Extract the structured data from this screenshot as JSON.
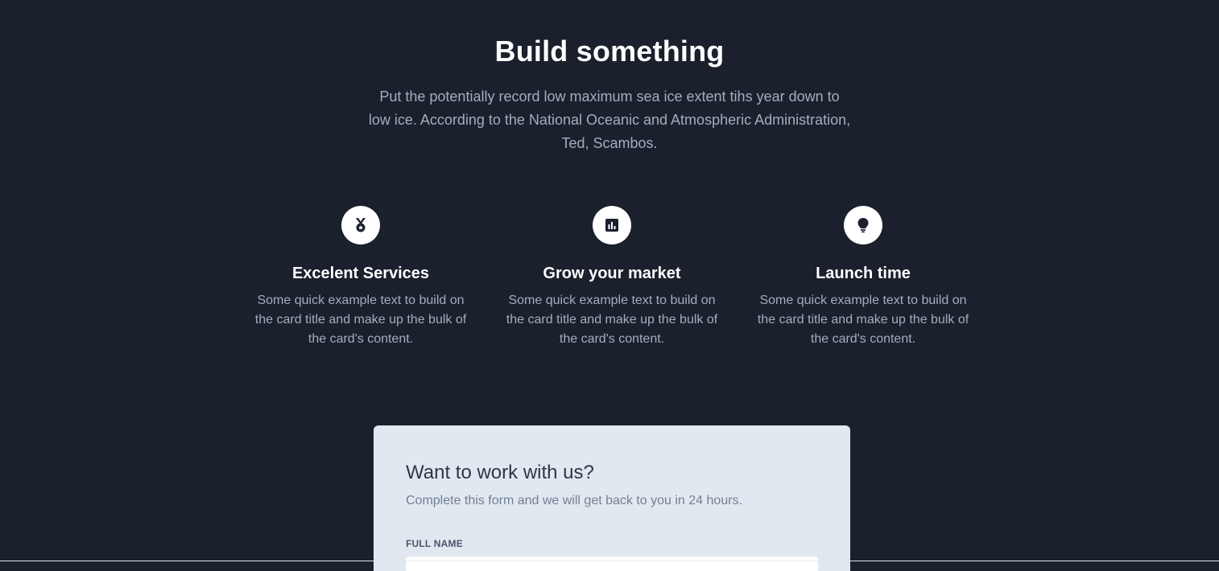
{
  "hero": {
    "title": "Build something",
    "description": "Put the potentially record low maximum sea ice extent tihs year down to low ice. According to the National Oceanic and Atmospheric Administration, Ted, Scambos."
  },
  "features": [
    {
      "icon": "medal-icon",
      "title": "Excelent Services",
      "text": "Some quick example text to build on the card title and make up the bulk of the card's content."
    },
    {
      "icon": "chart-icon",
      "title": "Grow your market",
      "text": "Some quick example text to build on the card title and make up the bulk of the card's content."
    },
    {
      "icon": "lightbulb-icon",
      "title": "Launch time",
      "text": "Some quick example text to build on the card title and make up the bulk of the card's content."
    }
  ],
  "form": {
    "title": "Want to work with us?",
    "subtitle": "Complete this form and we will get back to you in 24 hours.",
    "full_name_label": "FULL NAME",
    "full_name_value": ""
  },
  "colors": {
    "background": "#1a202c",
    "card": "#e2e8f0",
    "muted_text": "#a0aec0"
  }
}
